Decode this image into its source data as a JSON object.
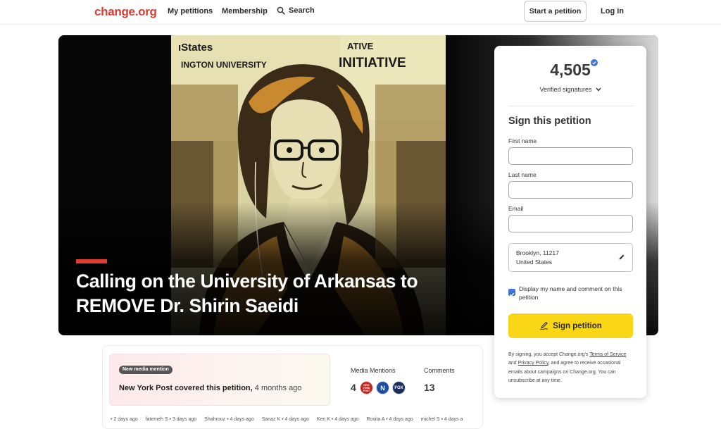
{
  "nav": {
    "logo": "change.org",
    "my_petitions": "My petitions",
    "membership": "Membership",
    "search": "Search",
    "start_petition": "Start a petition",
    "login": "Log in"
  },
  "hero": {
    "title": "Calling on the University of Arkansas to REMOVE Dr. Shirin Saeidi",
    "image_text": {
      "left_sign": "ıStates",
      "university": "INGTON UNIVERSITY",
      "initiative": "INITIATIVE",
      "top_right": "ATIVE"
    }
  },
  "sign_card": {
    "count": "4,505",
    "verified_label": "Verified signatures",
    "heading": "Sign this petition",
    "first_name_label": "First name",
    "last_name_label": "Last name",
    "email_label": "Email",
    "location_line1": "Brooklyn, 11217",
    "location_line2": "United States",
    "display_checkbox_label": "Display my name and comment on this petition",
    "display_checked": true,
    "sign_button": "Sign petition",
    "legal": {
      "p1": "By signing, you accept Change.org's ",
      "terms": "Terms of Service",
      "p2": " and ",
      "privacy": "Privacy Policy",
      "p3": ", and agree to receive occasional emails about campaigns on Change.org. You can unsubscribe at any time."
    }
  },
  "media": {
    "badge": "New media mention",
    "outlet": "New York Post covered this petition,",
    "ago": "4 months ago"
  },
  "stats": {
    "media_label": "Media Mentions",
    "media_count": "4",
    "comments_label": "Comments",
    "comments_count": "13",
    "outlets": [
      "NEW YORK POST",
      "N",
      "FOX"
    ]
  },
  "recent_signers": [
    "• 2 days ago",
    "fatemeh S • 3 days ago",
    "Shahrooz • 4 days ago",
    "Sanaz K • 4 days ago",
    "Ken K • 4 days ago",
    "Rosita A • 4 days ago",
    "michel S • 4 days a"
  ],
  "colors": {
    "brand_red": "#e03c31",
    "sign_yellow": "#f9d616",
    "verified_blue": "#3f73d6"
  }
}
